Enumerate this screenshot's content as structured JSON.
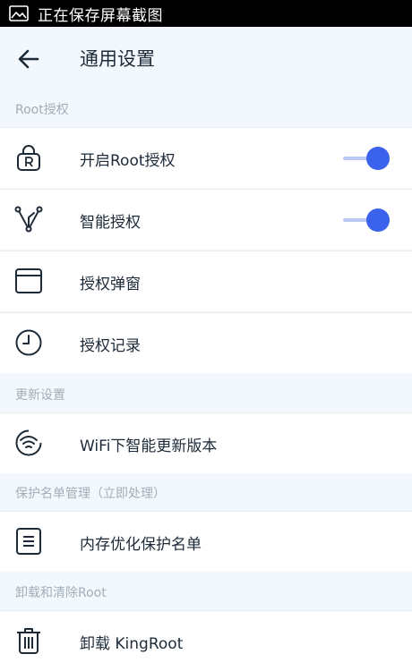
{
  "status_bar": {
    "text": "正在保存屏幕截图",
    "icon": "image-icon"
  },
  "header": {
    "title": "通用设置",
    "back_icon": "arrow-left-icon"
  },
  "sections": [
    {
      "label": "Root授权"
    },
    {
      "label": "更新设置"
    },
    {
      "label": "保护名单管理（立即处理）"
    },
    {
      "label": "卸载和清除Root"
    }
  ],
  "rows": {
    "enable_root": {
      "label": "开启Root授权",
      "icon": "lock-r-icon",
      "toggle": true
    },
    "smart_auth": {
      "label": "智能授权",
      "icon": "branch-icon",
      "toggle": true
    },
    "auth_popup": {
      "label": "授权弹窗",
      "icon": "window-icon"
    },
    "auth_log": {
      "label": "授权记录",
      "icon": "clock-icon"
    },
    "wifi_update": {
      "label": "WiFi下智能更新版本",
      "icon": "wifi-icon"
    },
    "memory_protect": {
      "label": "内存优化保护名单",
      "icon": "list-icon"
    },
    "uninstall": {
      "label": "卸载 KingRoot",
      "icon": "trash-icon"
    }
  },
  "colors": {
    "accent": "#3a62ec",
    "icon": "#1d2a38",
    "section_text": "#a3aeb8",
    "background": "#f2f8fd"
  }
}
